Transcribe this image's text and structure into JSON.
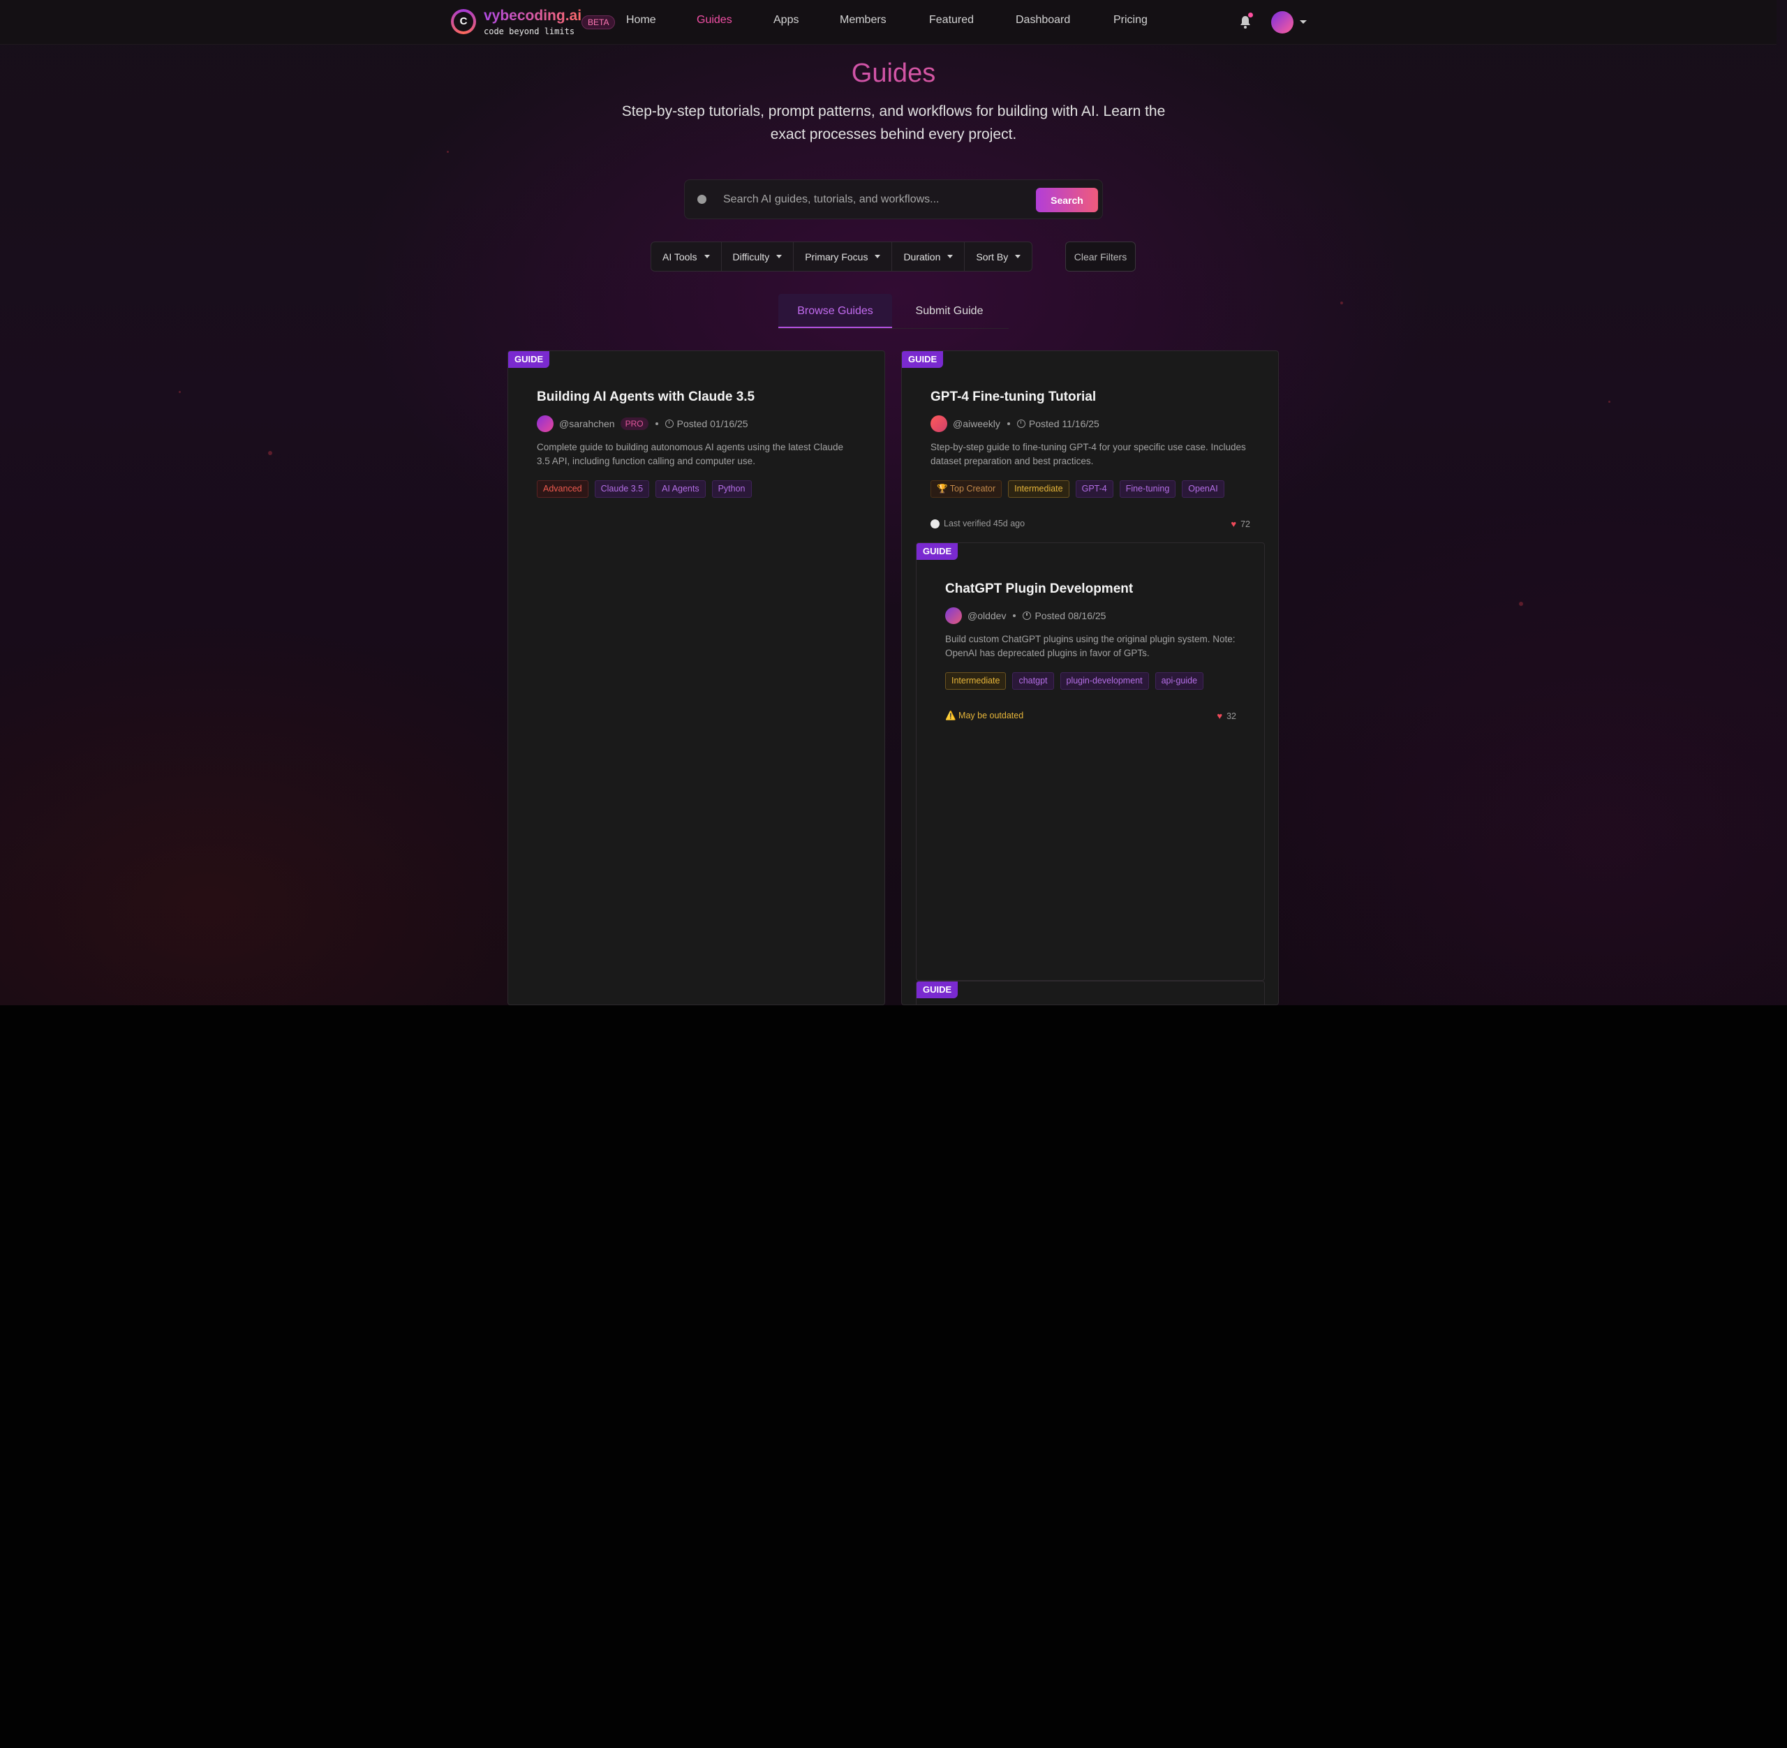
{
  "brand": {
    "logo_letter": "C",
    "name": "vybecoding.ai",
    "tagline": "code beyond limits",
    "badge": "BETA"
  },
  "nav": {
    "links": [
      {
        "label": "Home"
      },
      {
        "label": "Guides"
      },
      {
        "label": "Apps"
      },
      {
        "label": "Members"
      },
      {
        "label": "Featured"
      },
      {
        "label": "Dashboard"
      },
      {
        "label": "Pricing"
      }
    ],
    "active": "Guides"
  },
  "hero": {
    "title": "Guides",
    "subtitle": "Step-by-step tutorials, prompt patterns, and workflows for building with AI. Learn the exact processes behind every project."
  },
  "search": {
    "placeholder": "Search AI guides, tutorials, and workflows...",
    "button": "Search"
  },
  "filters": {
    "items": [
      {
        "label": "AI Tools"
      },
      {
        "label": "Difficulty"
      },
      {
        "label": "Primary Focus"
      },
      {
        "label": "Duration"
      },
      {
        "label": "Sort By"
      }
    ],
    "clear_label": "Clear Filters"
  },
  "tabs": {
    "browse": "Browse Guides",
    "submit": "Submit Guide"
  },
  "colors": {
    "accent_purple": "#b451e2",
    "accent_pink": "#f04fa4",
    "badge_purple": "#7a2ad0"
  },
  "cards": [
    {
      "badge": "GUIDE",
      "title": "Building AI Agents with Claude 3.5",
      "author": "@sarahchen",
      "author_badge": "PRO",
      "posted": "Posted 01/16/25",
      "description": "Complete guide to building autonomous AI agents using the latest Claude 3.5 API, including function calling and computer use.",
      "tags": [
        "Advanced",
        "Claude 3.5",
        "AI Agents",
        "Python"
      ]
    },
    {
      "badge": "GUIDE",
      "title": "GPT-4 Fine-tuning Tutorial",
      "author": "@aiweekly",
      "posted": "Posted 11/16/25",
      "description": "Step-by-step guide to fine-tuning GPT-4 for your specific use case. Includes dataset preparation and best practices.",
      "tags": [
        "🏆 Top Creator",
        "Intermediate",
        "GPT-4",
        "Fine-tuning",
        "OpenAI"
      ],
      "status": "Last verified 45d ago",
      "likes": "72"
    },
    {
      "badge": "GUIDE",
      "title": "ChatGPT Plugin Development",
      "author": "@olddev",
      "posted": "Posted 08/16/25",
      "description": "Build custom ChatGPT plugins using the original plugin system. Note: OpenAI has deprecated plugins in favor of GPTs.",
      "tags": [
        "Intermediate",
        "chatgpt",
        "plugin-development",
        "api-guide"
      ],
      "status": "⚠️ May be outdated",
      "likes": "32"
    },
    {
      "badge": "GUIDE"
    }
  ]
}
